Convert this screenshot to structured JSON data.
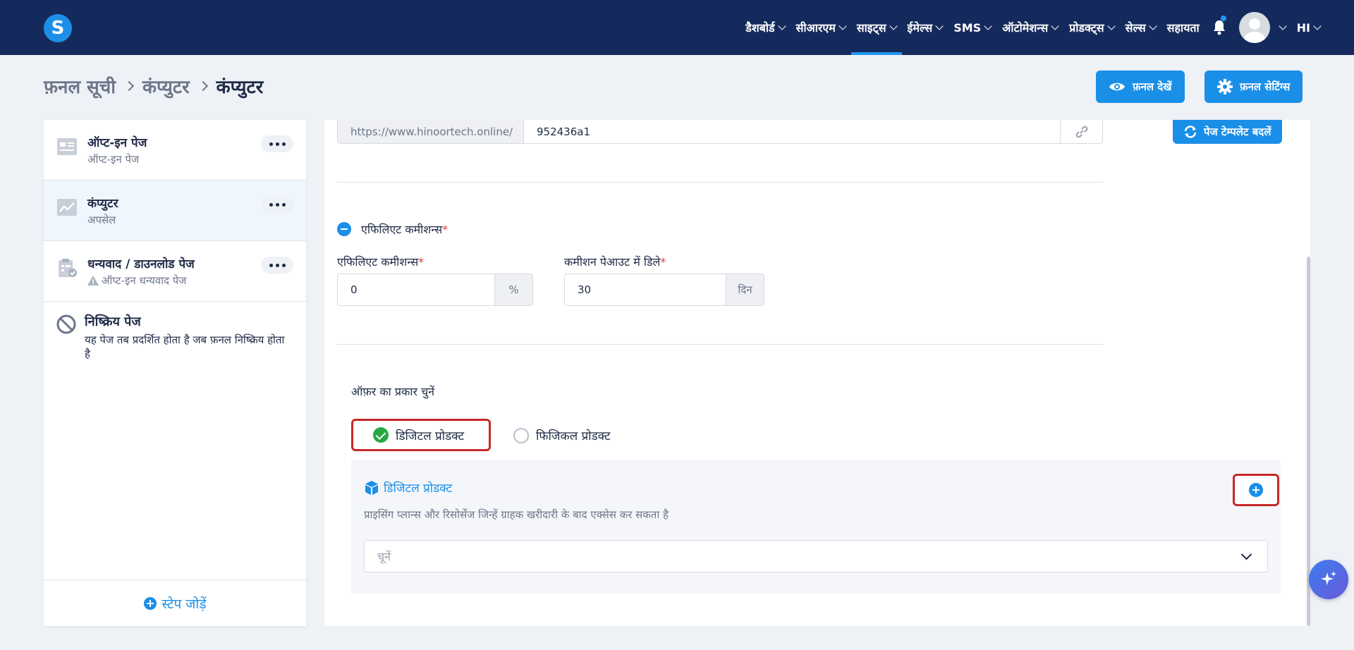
{
  "nav": {
    "logo": "S",
    "items": [
      {
        "label": "डैशबोर्ड"
      },
      {
        "label": "सीआरएम"
      },
      {
        "label": "साइट्स"
      },
      {
        "label": "ईमेल्स"
      },
      {
        "label": "SMS"
      },
      {
        "label": "ऑटोमेशन्स"
      },
      {
        "label": "प्रोडक्ट्स"
      },
      {
        "label": "सेल्स"
      }
    ],
    "active_item": "साइट्स",
    "help": "सहायता",
    "lang": "HI"
  },
  "header": {
    "breadcrumb": [
      "फ़नल सूची",
      "कंप्युटर",
      "कंप्युटर"
    ],
    "view_funnel": "फ़नल देखें",
    "funnel_settings": "फ़नल सेटिंग्स"
  },
  "sidebar": {
    "steps": [
      {
        "title": "ऑप्ट-इन पेज",
        "subtitle": "ऑप्ट-इन पेज",
        "icon": "form-page-icon"
      },
      {
        "title": "कंप्युटर",
        "subtitle": "अपसेल",
        "icon": "upsell-chart-icon"
      },
      {
        "title": "धन्यवाद / डाउनलोड पेज",
        "subtitle": "ऑप्ट-इन धन्यवाद पेज",
        "icon": "clipboard-check-icon"
      }
    ],
    "inactive_title": "निष्क्रिय पेज",
    "inactive_desc": "यह पेज तब प्रदर्शित होता है जब फ़नल निष्क्रिय होता है",
    "add_step": "स्टेप जोड़ें"
  },
  "main": {
    "url_prefix": "https://www.hinoortech.online/",
    "url_slug": "952436a1",
    "change_template": "पेज टेम्पलेट बदलें",
    "affiliate_section": "एफिलिएट कमीशन्स",
    "affiliate_label": "एफिलिएट कमीशन्स",
    "affiliate_value": "0",
    "affiliate_unit": "%",
    "payout_label": "कमीशन पेआउट में डिले",
    "payout_value": "30",
    "payout_unit": "दिन",
    "offer_type_label": "ऑफ़र का प्रकार चुनें",
    "digital_product": "डिजिटल प्रोडक्ट",
    "physical_product": "फिजिकल प्रोडक्ट",
    "dp_title": "डिजिटल प्रोडक्ट",
    "dp_desc": "प्राइसिंग प्लान्स और रिसोर्सेज जिन्हें ग्राहक खरीदारी के बाद एक्सेस कर सकता है",
    "dp_select_placeholder": "चूनें"
  },
  "colors": {
    "navbar": "#152a5c",
    "accent": "#1a8fe8",
    "highlight_border": "#c62828",
    "success": "#28a745"
  }
}
